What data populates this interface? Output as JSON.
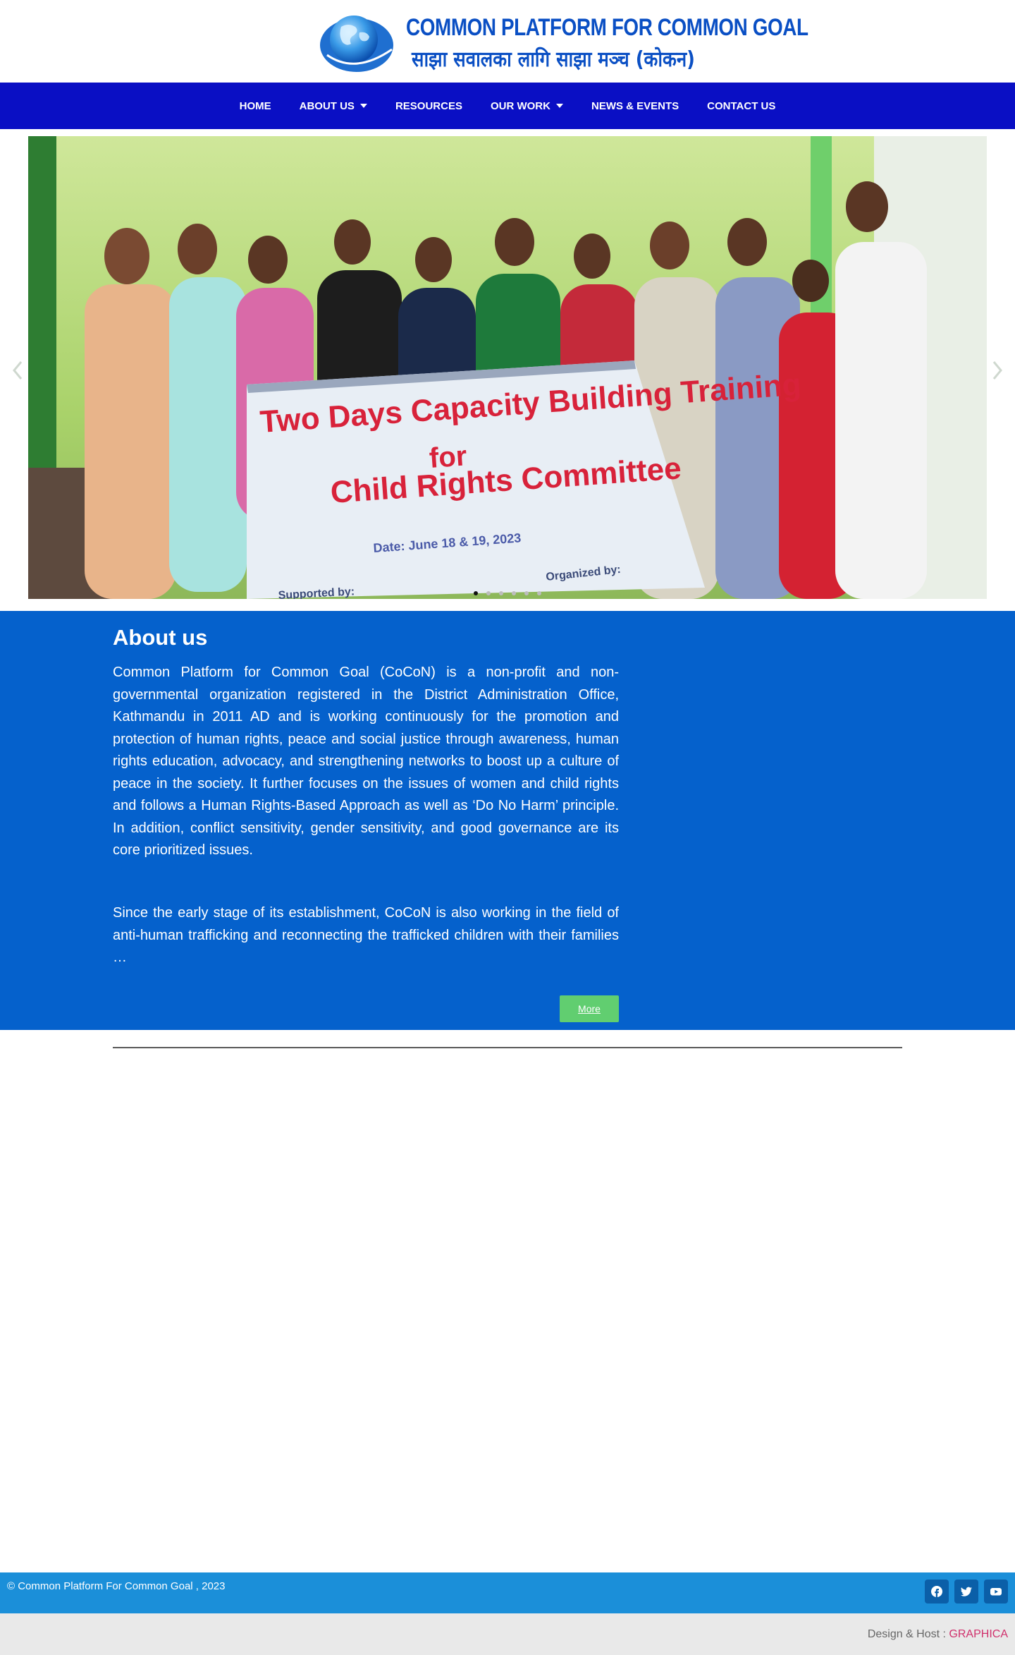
{
  "brand": {
    "title": "COMMON PLATFORM FOR COMMON GOAL",
    "subtitle": "साझा सवालका लागि साझा मञ्च (कोकन)",
    "globe_text": "Common Platform for Common Goal"
  },
  "nav": {
    "items": [
      {
        "label": "HOME",
        "dropdown": false
      },
      {
        "label": "ABOUT US",
        "dropdown": true
      },
      {
        "label": "RESOURCES",
        "dropdown": false
      },
      {
        "label": "OUR WORK",
        "dropdown": true
      },
      {
        "label": "NEWS & EVENTS",
        "dropdown": false
      },
      {
        "label": "CONTACT US",
        "dropdown": false
      }
    ]
  },
  "slider": {
    "banner_line1": "Two Days Capacity Building Training",
    "banner_line2": "for",
    "banner_line3": "Child Rights Committee",
    "banner_date": "Date: June 18 & 19, 2023",
    "banner_organized": "Organized by:",
    "banner_supported": "Supported by:",
    "slide_count": 6,
    "active_slide": 1
  },
  "about": {
    "title": "About us",
    "paragraph1": "Common Platform for Common Goal (CoCoN) is a non-profit and non-governmental organization registered in the District Administration Office, Kathmandu in 2011 AD and is working continuously for the promotion and protection of human rights, peace and social justice through awareness, human rights education, advocacy, and strengthening networks to boost up a culture of peace in the society. It further focuses on the issues of women and child rights and follows a Human Rights-Based Approach as well as ‘Do No Harm’ principle. In addition, conflict sensitivity, gender sensitivity, and good governance are its core prioritized issues.",
    "paragraph2": "Since the early stage of its establishment, CoCoN is also working in the field of anti-human trafficking and reconnecting the trafficked children with their families  …",
    "more_label": "More"
  },
  "footer": {
    "copyright": "©  Common Platform For Common Goal , 2023",
    "social_icons": [
      "facebook-icon",
      "twitter-icon",
      "youtube-icon"
    ],
    "credit_prefix": "Design & Host : ",
    "credit_link": "GRAPHICA"
  },
  "colors": {
    "nav_bg": "#0a0fc4",
    "about_bg": "#0561cc",
    "more_button": "#61ce70",
    "footer_bg": "#1b8fd9",
    "credit_link": "#d0306c",
    "brand_blue": "#0a4fc4"
  }
}
